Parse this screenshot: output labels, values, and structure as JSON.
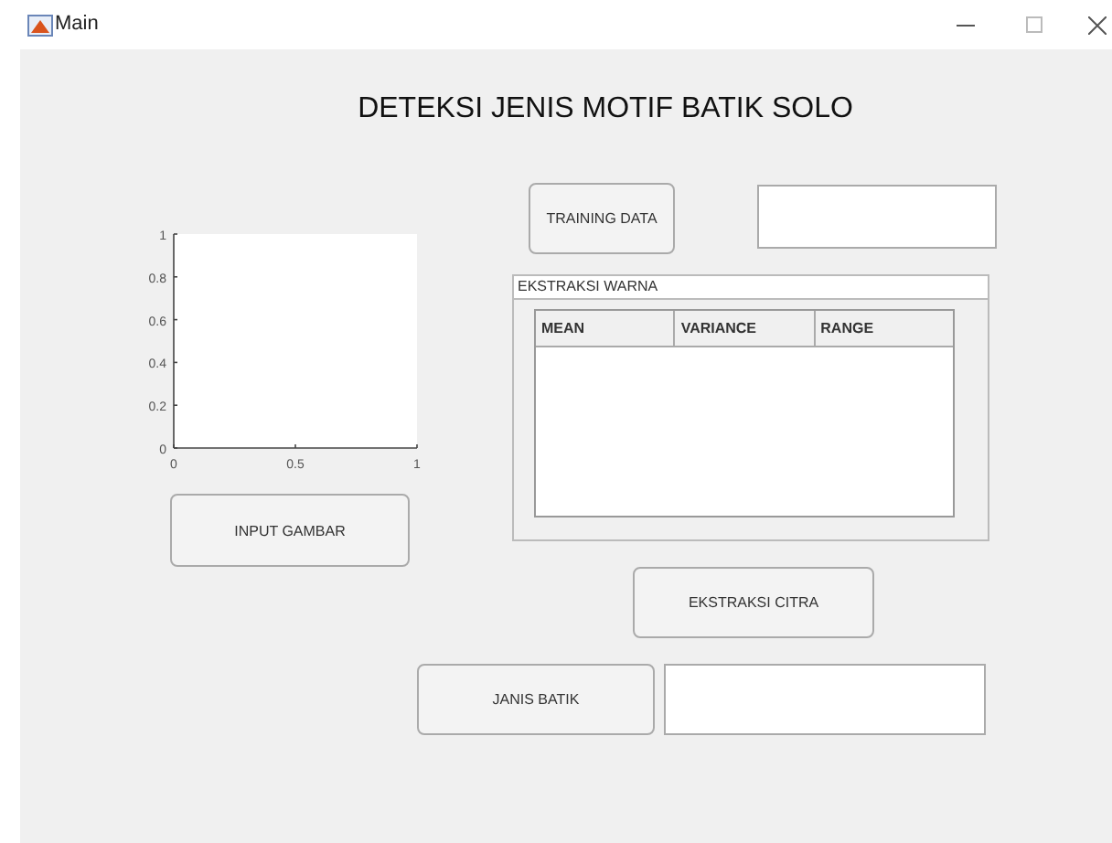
{
  "window": {
    "title": "Main"
  },
  "heading": "DETEKSI JENIS MOTIF BATIK SOLO",
  "axes": {
    "x_tick_labels": [
      "0",
      "0.5",
      "1"
    ],
    "y_tick_labels": [
      "1",
      "0.8",
      "0.6",
      "0.4",
      "0.2",
      "0"
    ]
  },
  "buttons": [
    {
      "label": "TRAINING DATA",
      "kind": "training"
    },
    {
      "label": "INPUT GAMBAR",
      "kind": "input"
    },
    {
      "label": "EKSTRAKSI CITRA",
      "kind": "extract"
    },
    {
      "label": "JANIS BATIK",
      "kind": "type"
    }
  ],
  "panel": {
    "title": "EKSTRAKSI WARNA",
    "table": {
      "columns": [
        "MEAN",
        "VARIANCE",
        "RANGE"
      ]
    }
  }
}
